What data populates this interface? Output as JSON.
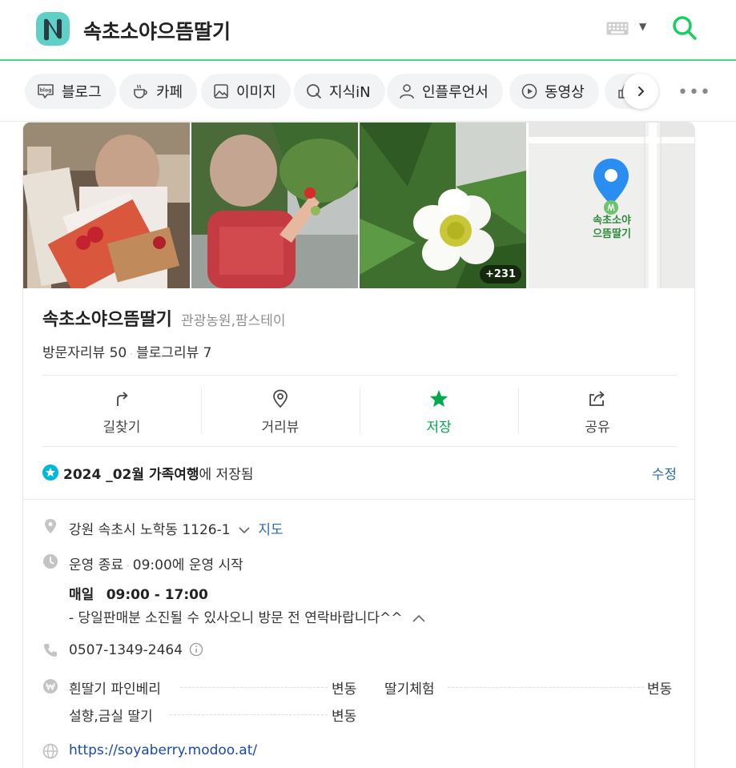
{
  "header": {
    "query": "속초소야으뜸딸기",
    "logo_icon": "naver-n-logo-icon",
    "keyboard_icon": "keyboard-icon",
    "search_icon": "search-icon",
    "accent": "#19ce60"
  },
  "tabs": [
    {
      "label": "블로그",
      "icon": "blog-icon"
    },
    {
      "label": "카페",
      "icon": "cafe-icon"
    },
    {
      "label": "이미지",
      "icon": "image-icon"
    },
    {
      "label": "지식iN",
      "icon": "kin-icon"
    },
    {
      "label": "인플루언서",
      "icon": "person-icon"
    },
    {
      "label": "동영상",
      "icon": "play-icon"
    }
  ],
  "photos": {
    "count_badge": "+231",
    "map_pin_label_line1": "속초소야",
    "map_pin_label_line2": "으뜸딸기"
  },
  "place": {
    "name": "속초소야으뜸딸기",
    "category": "관광농원,팜스테이",
    "visitor_reviews": "방문자리뷰 50",
    "blog_reviews": "블로그리뷰 7"
  },
  "actions": [
    {
      "label": "길찾기",
      "icon": "directions-icon"
    },
    {
      "label": "거리뷰",
      "icon": "street-view-icon"
    },
    {
      "label": "저장",
      "icon": "star-icon"
    },
    {
      "label": "공유",
      "icon": "share-icon"
    }
  ],
  "saved": {
    "folder": "2024 _02월 가족여행",
    "suffix": "에 저장됨",
    "edit": "수정"
  },
  "info": {
    "address": "강원 속초시 노학동 1126-1",
    "map_link": "지도",
    "status": "운영 종료",
    "start_time": "09:00",
    "start_suffix": "에 운영 시작",
    "hours_day": "매일",
    "hours_range": "09:00 - 17:00",
    "hours_note": "- 당일판매분 소진될 수 있사오니 방문 전 연락바랍니다^^",
    "phone": "0507-1349-2464",
    "menu": [
      {
        "name": "흰딸기 파인베리",
        "price": "변동"
      },
      {
        "name": "딸기체험",
        "price": "변동"
      },
      {
        "name": "설향,금실 딸기",
        "price": "변동"
      }
    ],
    "website": "https://soyaberry.modoo.at/"
  }
}
